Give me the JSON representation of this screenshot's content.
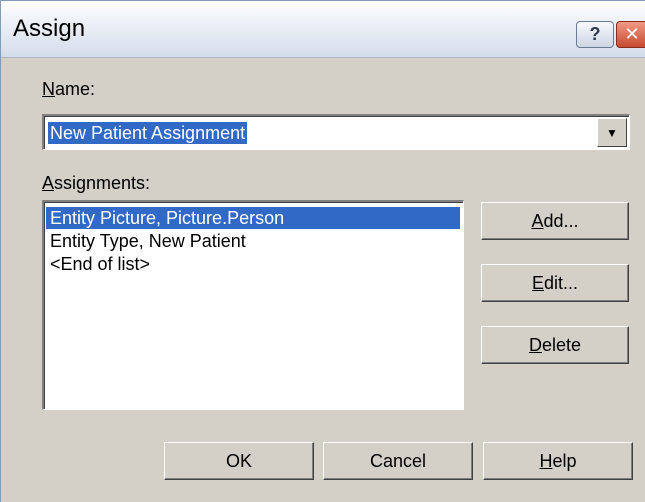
{
  "window": {
    "title": "Assign",
    "help_button_label": "?",
    "close_button_label": "✕"
  },
  "name_section": {
    "label_hotkey": "N",
    "label_rest": "ame:",
    "combo_value": "New Patient Assignment",
    "dropdown_arrow": "▼"
  },
  "assignments_section": {
    "label_hotkey": "A",
    "label_rest": "ssignments:",
    "items": [
      "Entity Picture, Picture.Person",
      "Entity Type, New Patient",
      "<End of list>"
    ]
  },
  "side_buttons": {
    "add": {
      "hotkey": "A",
      "rest": "dd..."
    },
    "edit": {
      "hotkey": "E",
      "rest": "dit..."
    },
    "delete": {
      "hotkey": "D",
      "rest": "elete"
    }
  },
  "footer_buttons": {
    "ok": "OK",
    "cancel": "Cancel",
    "help": {
      "hotkey": "H",
      "rest": "elp"
    }
  }
}
